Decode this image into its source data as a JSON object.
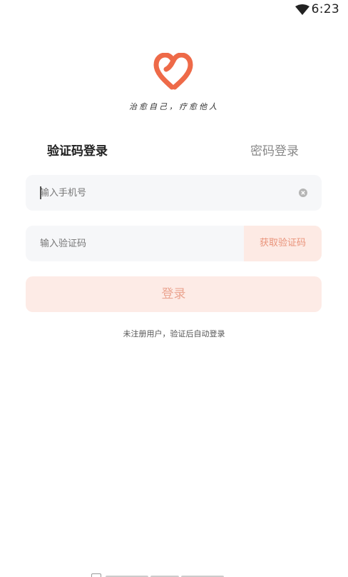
{
  "status_bar": {
    "time": "6:23"
  },
  "slogan": "治愈自己，疗愈他人",
  "tabs": {
    "sms_login": "验证码登录",
    "password_login": "密码登录"
  },
  "phone_field": {
    "placeholder": "输入手机号"
  },
  "code_field": {
    "placeholder": "输入验证码",
    "get_code_label": "获取验证码"
  },
  "login_button": "登录",
  "hint": "未注册用户，验证后自动登录",
  "colors": {
    "brand": "#ee6a48",
    "button_bg": "#fdebe6",
    "field_bg": "#f6f7f9"
  }
}
